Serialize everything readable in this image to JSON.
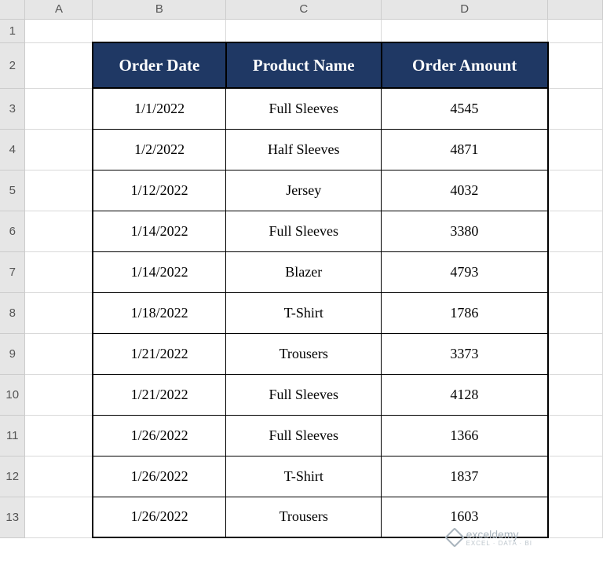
{
  "columns": [
    "A",
    "B",
    "C",
    "D"
  ],
  "rows": [
    "1",
    "2",
    "3",
    "4",
    "5",
    "6",
    "7",
    "8",
    "9",
    "10",
    "11",
    "12",
    "13"
  ],
  "header": {
    "order_date": "Order Date",
    "product_name": "Product Name",
    "order_amount": "Order Amount"
  },
  "data": [
    {
      "date": "1/1/2022",
      "product": "Full Sleeves",
      "amount": "4545"
    },
    {
      "date": "1/2/2022",
      "product": "Half Sleeves",
      "amount": "4871"
    },
    {
      "date": "1/12/2022",
      "product": "Jersey",
      "amount": "4032"
    },
    {
      "date": "1/14/2022",
      "product": "Full Sleeves",
      "amount": "3380"
    },
    {
      "date": "1/14/2022",
      "product": "Blazer",
      "amount": "4793"
    },
    {
      "date": "1/18/2022",
      "product": "T-Shirt",
      "amount": "1786"
    },
    {
      "date": "1/21/2022",
      "product": "Trousers",
      "amount": "3373"
    },
    {
      "date": "1/21/2022",
      "product": "Full Sleeves",
      "amount": "4128"
    },
    {
      "date": "1/26/2022",
      "product": "Full Sleeves",
      "amount": "1366"
    },
    {
      "date": "1/26/2022",
      "product": "T-Shirt",
      "amount": "1837"
    },
    {
      "date": "1/26/2022",
      "product": "Trousers",
      "amount": "1603"
    }
  ],
  "watermark": {
    "brand": "exceldemy",
    "tagline": "EXCEL · DATA · BI"
  }
}
